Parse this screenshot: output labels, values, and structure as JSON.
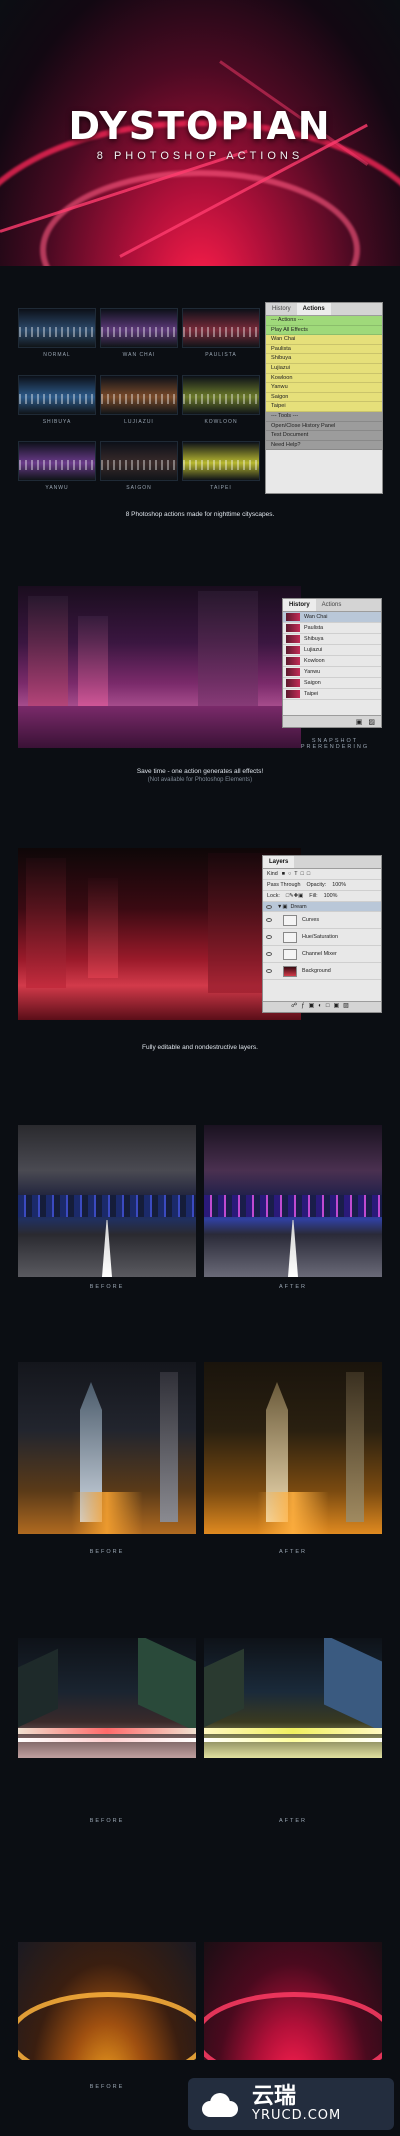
{
  "hero": {
    "title": "DYSTOPIAN",
    "subtitle": "8 PHOTOSHOP ACTIONS",
    "accent": "#ff2a5a"
  },
  "presets": [
    {
      "label": "NORMAL",
      "tint": "#2c4a6b"
    },
    {
      "label": "WAN CHAI",
      "tint": "#5d3a7a"
    },
    {
      "label": "PAULISTA",
      "tint": "#7a2b3a"
    },
    {
      "label": "SHIBUYA",
      "tint": "#2d5b8a"
    },
    {
      "label": "LUJIAZUI",
      "tint": "#7a4b2a"
    },
    {
      "label": "KOWLOON",
      "tint": "#6b7a2a"
    },
    {
      "label": "YANWU",
      "tint": "#6a3b8a"
    },
    {
      "label": "SAIGON",
      "tint": "#3a2b2b"
    },
    {
      "label": "TAIPEI",
      "tint": "#b8b830"
    }
  ],
  "actions_panel": {
    "tabs": [
      "History",
      "Actions"
    ],
    "rows": [
      {
        "label": "--- Actions ---",
        "kind": "green"
      },
      {
        "label": "Play All Effects",
        "kind": "green"
      },
      {
        "label": "Wan Chai",
        "kind": "yellow"
      },
      {
        "label": "Paulista",
        "kind": "yellow"
      },
      {
        "label": "Shibuya",
        "kind": "yellow"
      },
      {
        "label": "Lujiazui",
        "kind": "yellow"
      },
      {
        "label": "Kowloon",
        "kind": "yellow"
      },
      {
        "label": "Yanwu",
        "kind": "yellow"
      },
      {
        "label": "Saigon",
        "kind": "yellow"
      },
      {
        "label": "Taipei",
        "kind": "yellow"
      },
      {
        "label": "--- Tools ---",
        "kind": "gray"
      },
      {
        "label": "Open/Close History Panel",
        "kind": "gray"
      },
      {
        "label": "Test Document",
        "kind": "gray"
      },
      {
        "label": "Need Help?",
        "kind": "gray"
      }
    ]
  },
  "caption1": "8 Photoshop actions made for nighttime cityscapes.",
  "history_panel": {
    "tabs": [
      "History",
      "Actions"
    ],
    "rows": [
      "Wan Chai",
      "Paulista",
      "Shibuya",
      "Lujiazui",
      "Kowloon",
      "Yanwu",
      "Saigon",
      "Taipei"
    ],
    "selected_index": 0
  },
  "snapshot_label": "SNAPSHOT PRERENDERING",
  "caption2": "Save time - one action generates all effects!",
  "caption2_sub": "(Not available for Photoshop Elements)",
  "layers_panel": {
    "tab": "Layers",
    "kind_label": "Kind",
    "blend_mode": "Pass Through",
    "opacity_label": "Opacity:",
    "opacity_value": "100%",
    "lock_label": "Lock:",
    "fill_label": "Fill:",
    "fill_value": "100%",
    "group_name": "Dream",
    "layers": [
      "Curves",
      "Hue/Saturation",
      "Channel Mixer",
      "Background"
    ]
  },
  "caption3": "Fully editable and nondestructive layers.",
  "comparisons": [
    {
      "before": "BEFORE",
      "after": "AFTER"
    },
    {
      "before": "BEFORE",
      "after": "AFTER"
    },
    {
      "before": "BEFORE",
      "after": "AFTER"
    },
    {
      "before": "BEFORE",
      "after": ""
    }
  ],
  "watermark": {
    "line1": "云瑞",
    "line2": "YRUCD.COM"
  }
}
